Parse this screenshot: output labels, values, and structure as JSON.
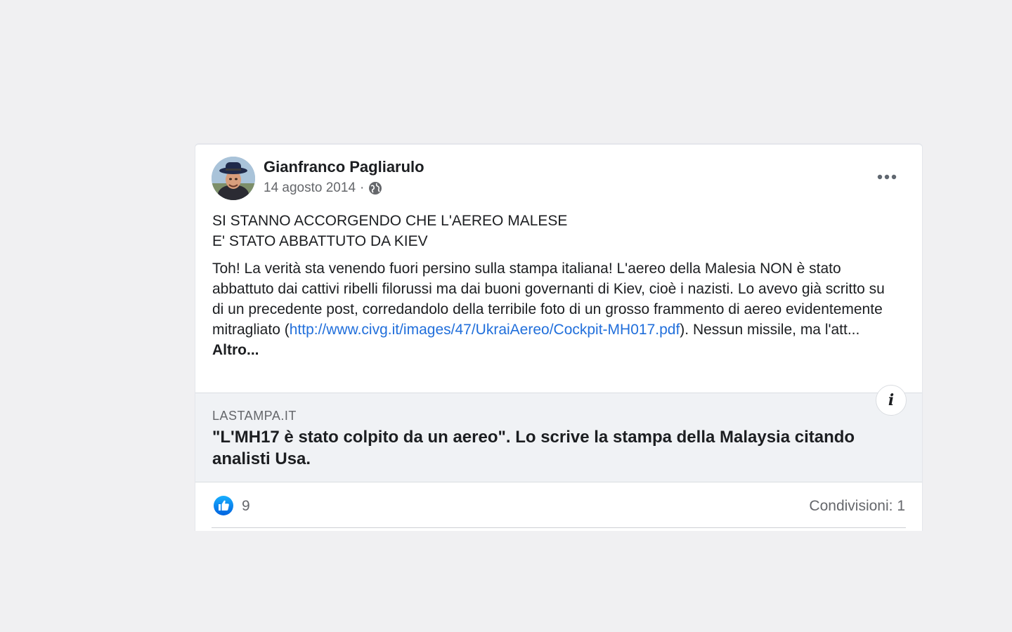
{
  "post": {
    "author": "Gianfranco Pagliarulo",
    "date": "14 agosto 2014",
    "separator": "·",
    "privacy_icon": "globe-icon",
    "more_icon": "ellipsis-icon",
    "title": "SI STANNO ACCORGENDO CHE L'AEREO MALESE\nE' STATO ABBATTUTO DA KIEV",
    "body_text": "Toh! La verità sta venendo fuori persino sulla stampa italiana! L'aereo della Malesia NON è stato abbattuto dai cattivi ribelli filorussi ma dai buoni governanti di Kiev, cioè i nazisti. Lo avevo già scritto su di un precedente post, corredandolo della terribile foto di un grosso frammento di aereo evidentemente mitragliato",
    "body_paren_open": "(",
    "body_link": "http://www.civg.it/images/47/UkraiAereo/Cockpit-MH017.pdf",
    "body_after_link": "). Nessun missile, ma l'att...",
    "see_more": "Altro..."
  },
  "link_preview": {
    "domain": "LASTAMPA.IT",
    "headline": "\"L'MH17 è stato colpito da un aereo\". Lo scrive la stampa della Malaysia citando analisti Usa.",
    "info_label": "i"
  },
  "reactions": {
    "like_icon": "thumbs-up-icon",
    "like_color": "#1877f2",
    "count": "9",
    "shares": "Condivisioni: 1"
  }
}
